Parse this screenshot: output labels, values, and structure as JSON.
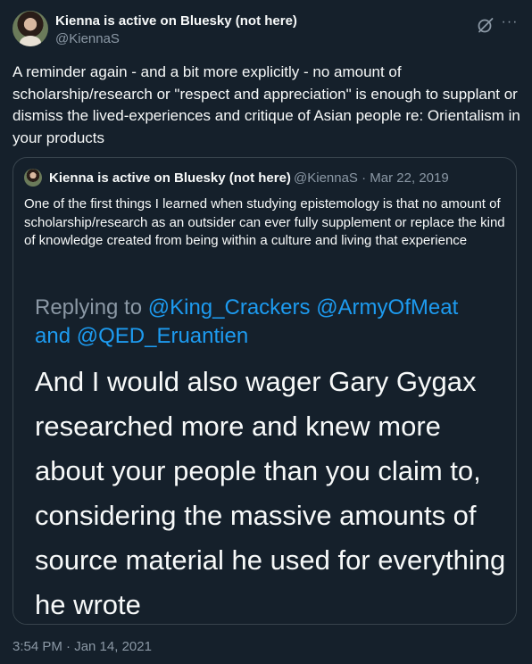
{
  "tweet": {
    "author_name": "Kienna is active on Bluesky (not here)",
    "author_handle": "@KiennaS",
    "text": "A reminder again - and a bit more explicitly - no amount of scholarship/research or \"respect and appreciation\" is enough to supplant or dismiss the lived-experiences and critique of Asian people re: Orientalism in your products",
    "timestamp": "3:54 PM · Jan 14, 2021",
    "more_label": "···"
  },
  "quote": {
    "author_name": "Kienna is active on Bluesky (not here)",
    "author_handle": "@KiennaS",
    "date": "Mar 22, 2019",
    "separator": "·",
    "text": "One of the first things I learned when studying epistemology is that no amount of scholarship/research as an outsider can ever fully supplement or replace the kind of knowledge created from being within a culture and living that experience",
    "image": {
      "replying_label": "Replying to",
      "mentions": [
        "@King_Crackers",
        "@ArmyOfMeat",
        "@QED_Eruantien"
      ],
      "and_label": "and",
      "body": "And I would also wager Gary Gygax researched more and knew more about your people than you claim to, considering the massive amounts of source material he used for everything he wrote"
    }
  },
  "colors": {
    "background": "#15202b",
    "text": "#f7f9f9",
    "secondary": "#8b98a5",
    "accent": "#1d9bf0",
    "border": "#38444d"
  },
  "icons": [
    "grok-icon",
    "more-icon"
  ]
}
